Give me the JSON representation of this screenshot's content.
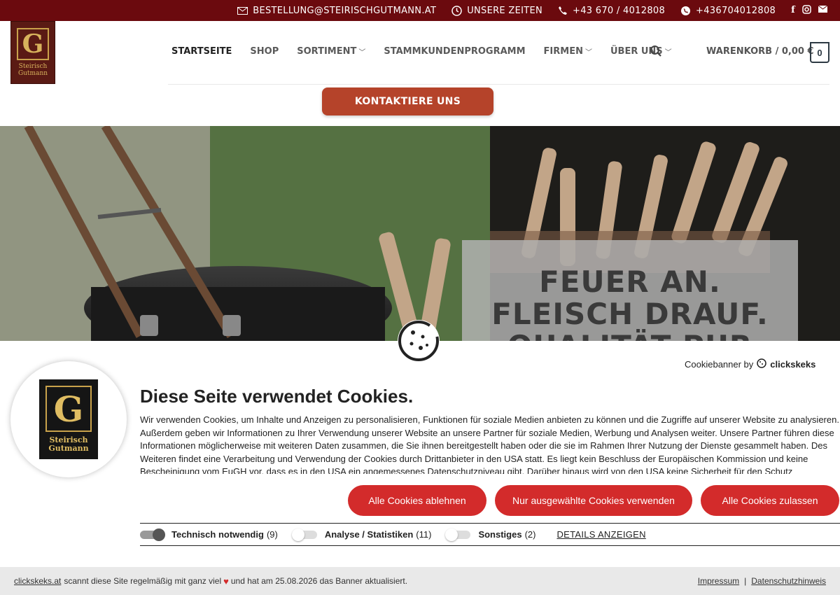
{
  "topbar": {
    "email": "BESTELLUNG@STEIRISCHGUTMANN.AT",
    "hours": "UNSERE ZEITEN",
    "phone": "+43 670 / 4012808",
    "whatsapp": "+436704012808",
    "icons": [
      "mail-icon",
      "clock-icon",
      "phone-icon",
      "whatsapp-icon",
      "facebook-icon",
      "instagram-icon",
      "email-icon"
    ]
  },
  "logo": {
    "letter": "G",
    "line1": "Steirisch",
    "line2": "Gutmann"
  },
  "nav": {
    "items": [
      "STARTSEITE",
      "SHOP",
      "SORTIMENT",
      "STAMMKUNDENPROGRAMM",
      "FIRMEN",
      "ÜBER UNS"
    ]
  },
  "cart": {
    "label": "WARENKORB / 0,00 €",
    "count": "0"
  },
  "contact_button": "KONTAKTIERE UNS",
  "hero": {
    "line1": "FEUER AN.",
    "line2": "FLEISCH DRAUF.",
    "line3": "QUALITÄT PUR"
  },
  "cookie": {
    "banner_by": "Cookiebanner by",
    "brand": "clickskeks",
    "title": "Diese Seite verwendet Cookies.",
    "description": "Wir verwenden Cookies, um Inhalte und Anzeigen zu personalisieren, Funktionen für soziale Medien anbieten zu können und die Zugriffe auf unserer Website zu analysieren. Außerdem geben wir Informationen zu Ihrer Verwendung unserer Website an unsere Partner für soziale Medien, Werbung und Analysen weiter. Unsere Partner führen diese Informationen möglicherweise mit weiteren Daten zusammen, die Sie ihnen bereitgestellt haben oder die sie im Rahmen Ihrer Nutzung der Dienste gesammelt haben. Des Weiteren findet eine Verarbeitung und Verwendung der Cookies durch Drittanbieter in den USA statt. Es liegt kein Beschluss der Europäischen Kommission und keine Bescheinigung vom EuGH vor, dass es in den USA ein angemessenes Datenschutzniveau gibt. Darüber hinaus wird von den USA keine Sicherheit für den Schutz",
    "buttons": {
      "decline": "Alle Cookies ablehnen",
      "selected": "Nur ausgewählte Cookies verwenden",
      "accept": "Alle Cookies zulassen"
    },
    "toggles": [
      {
        "label": "Technisch notwendig",
        "count": "(9)",
        "on": true
      },
      {
        "label": "Analyse / Statistiken",
        "count": "(11)",
        "on": false
      },
      {
        "label": "Sonstiges",
        "count": "(2)",
        "on": false
      }
    ],
    "details": "DETAILS ANZEIGEN"
  },
  "footer": {
    "link": "clickskeks.at",
    "text_a": "scannt diese Site regelmäßig mit ganz viel",
    "text_b": "und hat am 25.08.2026 das Banner aktualisiert.",
    "impressum": "Impressum",
    "separator": "|",
    "datenschutz": "Datenschutzhinweis"
  },
  "colors": {
    "topbar": "#6b0a0e",
    "contact": "#b5432a",
    "cookie_button": "#d32b2b"
  }
}
